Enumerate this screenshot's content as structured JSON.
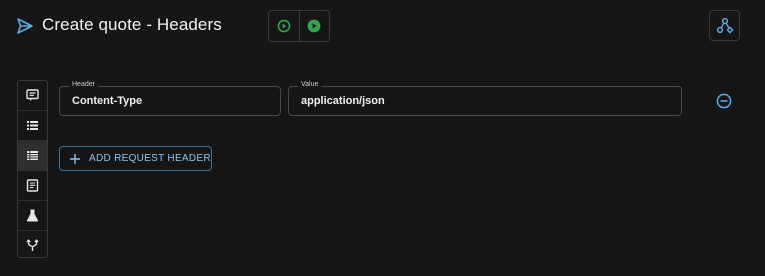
{
  "header": {
    "title": "Create quote - Headers",
    "send_icon": "send-icon",
    "run_buttons": [
      {
        "icon": "play-outline-icon"
      },
      {
        "icon": "play-filled-icon"
      }
    ],
    "share_icon": "share-icon"
  },
  "sidebar": {
    "items": [
      {
        "icon": "comment-icon",
        "active": false
      },
      {
        "icon": "list-icon",
        "active": false
      },
      {
        "icon": "table-list-icon",
        "active": true
      },
      {
        "icon": "document-icon",
        "active": false
      },
      {
        "icon": "flask-icon",
        "active": false
      },
      {
        "icon": "fork-icon",
        "active": false
      }
    ]
  },
  "headers_form": {
    "header_label": "Header",
    "value_label": "Value",
    "rows": [
      {
        "header": "Content-Type",
        "value": "application/json"
      }
    ],
    "remove_icon": "minus-circle-icon",
    "add_button_label": "ADD REQUEST HEADER",
    "add_icon": "plus-icon"
  },
  "colors": {
    "background": "#151515",
    "accent_blue": "#5aaee8",
    "run_green": "#2ea84a",
    "border": "#4a4a4a"
  }
}
